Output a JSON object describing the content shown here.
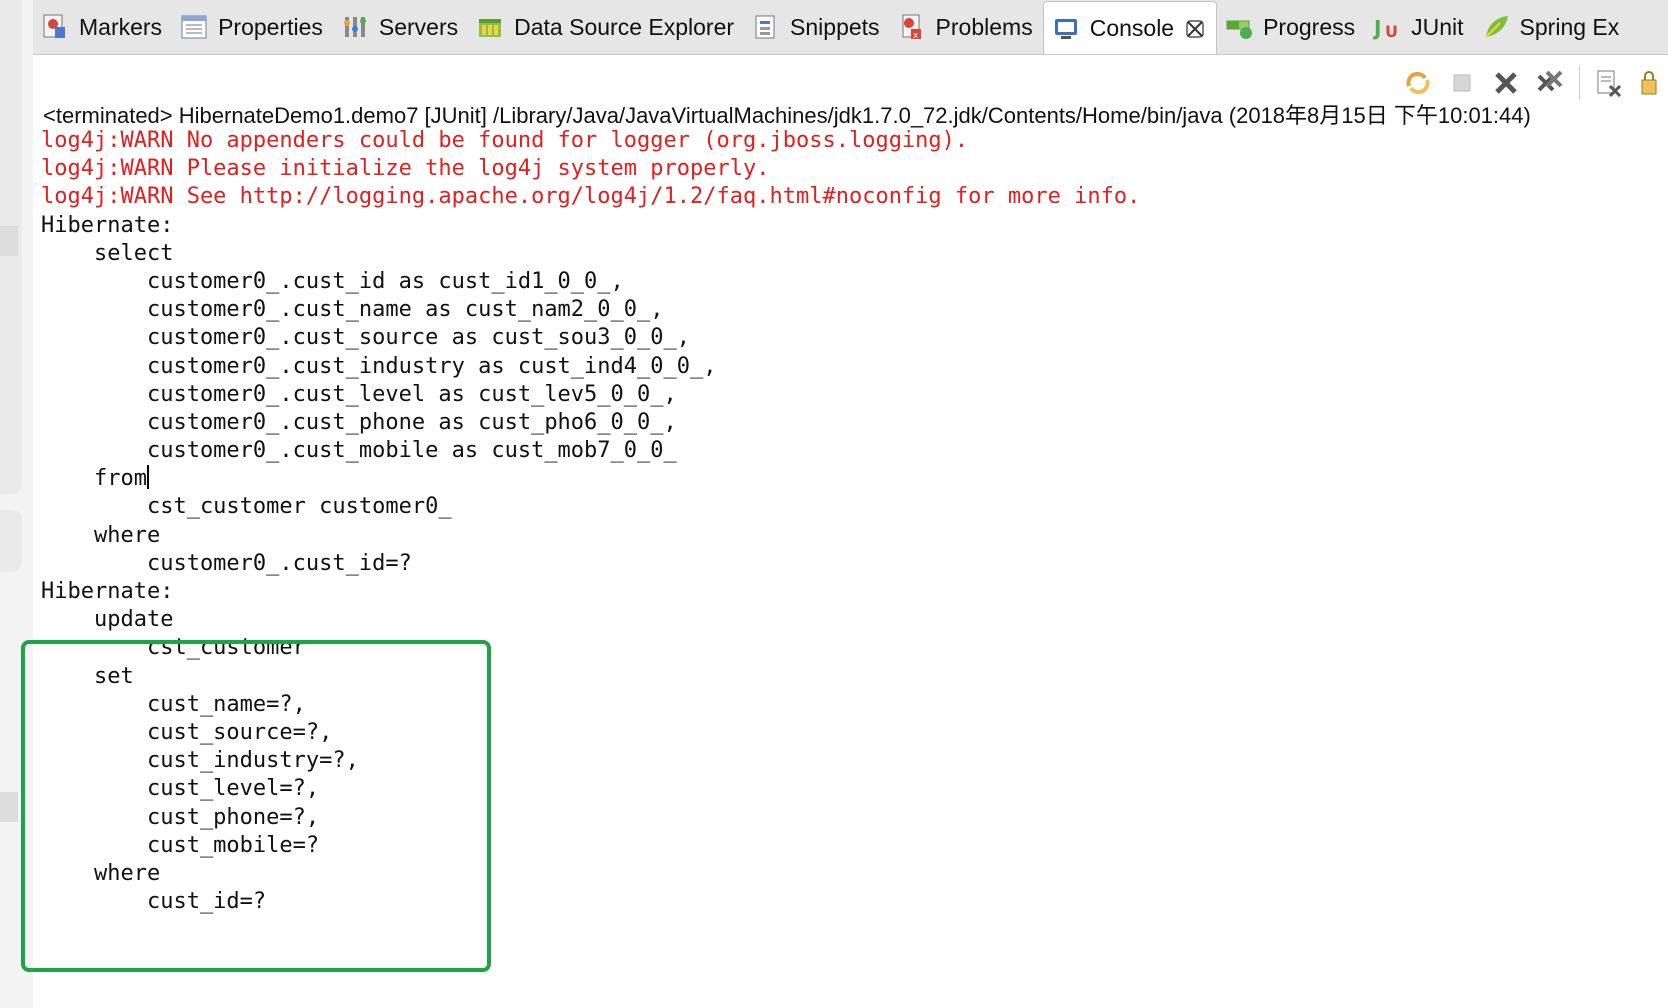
{
  "tabs": [
    {
      "label": "Markers",
      "icon": "markers-icon",
      "active": false
    },
    {
      "label": "Properties",
      "icon": "properties-icon",
      "active": false
    },
    {
      "label": "Servers",
      "icon": "servers-icon",
      "active": false
    },
    {
      "label": "Data Source Explorer",
      "icon": "data-source-explorer-icon",
      "active": false
    },
    {
      "label": "Snippets",
      "icon": "snippets-icon",
      "active": false
    },
    {
      "label": "Problems",
      "icon": "problems-icon",
      "active": false
    },
    {
      "label": "Console",
      "icon": "console-icon",
      "active": true
    },
    {
      "label": "Progress",
      "icon": "progress-icon",
      "active": false
    },
    {
      "label": "JUnit",
      "icon": "junit-icon",
      "active": false
    },
    {
      "label": "Spring Ex",
      "icon": "spring-explorer-icon",
      "active": false
    }
  ],
  "toolbar": {
    "icons": [
      "relaunch-icon",
      "terminate-icon",
      "remove-launch-icon",
      "remove-all-terminated-icon",
      "clear-console-icon",
      "scroll-lock-icon"
    ]
  },
  "console": {
    "process_line": "<terminated> HibernateDemo1.demo7 [JUnit] /Library/Java/JavaVirtualMachines/jdk1.7.0_72.jdk/Contents/Home/bin/java (2018年8月15日 下午10:01:44)",
    "lines": [
      {
        "text": "log4j:WARN No appenders could be found for logger (org.jboss.logging).",
        "kind": "warn"
      },
      {
        "text": "log4j:WARN Please initialize the log4j system properly.",
        "kind": "warn"
      },
      {
        "text": "log4j:WARN See http://logging.apache.org/log4j/1.2/faq.html#noconfig for more info.",
        "kind": "warn"
      },
      {
        "text": "Hibernate: ",
        "kind": "out"
      },
      {
        "text": "    select",
        "kind": "out"
      },
      {
        "text": "        customer0_.cust_id as cust_id1_0_0_,",
        "kind": "out"
      },
      {
        "text": "        customer0_.cust_name as cust_nam2_0_0_,",
        "kind": "out"
      },
      {
        "text": "        customer0_.cust_source as cust_sou3_0_0_,",
        "kind": "out"
      },
      {
        "text": "        customer0_.cust_industry as cust_ind4_0_0_,",
        "kind": "out"
      },
      {
        "text": "        customer0_.cust_level as cust_lev5_0_0_,",
        "kind": "out"
      },
      {
        "text": "        customer0_.cust_phone as cust_pho6_0_0_,",
        "kind": "out"
      },
      {
        "text": "        customer0_.cust_mobile as cust_mob7_0_0_ ",
        "kind": "out"
      },
      {
        "text": "    from",
        "kind": "out",
        "caret": true
      },
      {
        "text": "        cst_customer customer0_ ",
        "kind": "out"
      },
      {
        "text": "    where",
        "kind": "out"
      },
      {
        "text": "        customer0_.cust_id=?",
        "kind": "out"
      },
      {
        "text": "Hibernate: ",
        "kind": "out"
      },
      {
        "text": "    update",
        "kind": "out"
      },
      {
        "text": "        cst_customer ",
        "kind": "out"
      },
      {
        "text": "    set",
        "kind": "out"
      },
      {
        "text": "        cust_name=?,",
        "kind": "out"
      },
      {
        "text": "        cust_source=?,",
        "kind": "out"
      },
      {
        "text": "        cust_industry=?,",
        "kind": "out"
      },
      {
        "text": "        cust_level=?,",
        "kind": "out"
      },
      {
        "text": "        cust_phone=?,",
        "kind": "out"
      },
      {
        "text": "        cust_mobile=? ",
        "kind": "out"
      },
      {
        "text": "    where",
        "kind": "out"
      },
      {
        "text": "        cust_id=?",
        "kind": "out"
      }
    ]
  },
  "colors": {
    "warn_text": "#e0201f",
    "normal_text": "#111111",
    "highlight_border": "#1fa34a"
  }
}
